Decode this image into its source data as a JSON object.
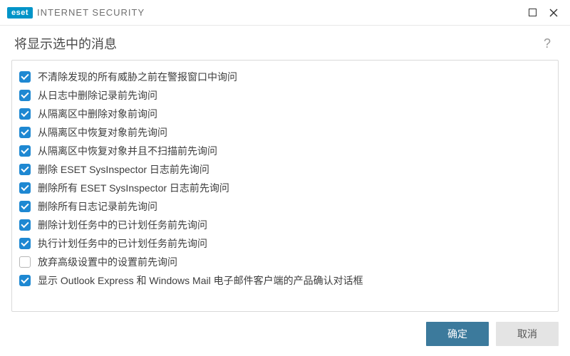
{
  "titlebar": {
    "brand_badge": "eset",
    "product_name": "INTERNET SECURITY"
  },
  "header": {
    "title": "将显示选中的消息",
    "help_label": "?"
  },
  "options": [
    {
      "checked": true,
      "label": "不清除发现的所有威胁之前在警报窗口中询问"
    },
    {
      "checked": true,
      "label": "从日志中删除记录前先询问"
    },
    {
      "checked": true,
      "label": "从隔离区中删除对象前询问"
    },
    {
      "checked": true,
      "label": "从隔离区中恢复对象前先询问"
    },
    {
      "checked": true,
      "label": "从隔离区中恢复对象并且不扫描前先询问"
    },
    {
      "checked": true,
      "label": "删除 ESET SysInspector 日志前先询问"
    },
    {
      "checked": true,
      "label": "删除所有 ESET SysInspector 日志前先询问"
    },
    {
      "checked": true,
      "label": "删除所有日志记录前先询问"
    },
    {
      "checked": true,
      "label": "删除计划任务中的已计划任务前先询问"
    },
    {
      "checked": true,
      "label": "执行计划任务中的已计划任务前先询问"
    },
    {
      "checked": false,
      "label": "放弃高级设置中的设置前先询问"
    },
    {
      "checked": true,
      "label": "显示 Outlook Express 和 Windows Mail 电子邮件客户端的产品确认对话框"
    }
  ],
  "footer": {
    "ok_label": "确定",
    "cancel_label": "取消"
  }
}
